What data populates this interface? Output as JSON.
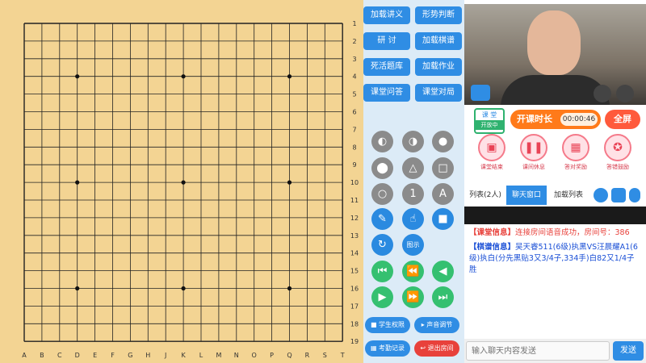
{
  "board": {
    "col_labels": [
      "A",
      "B",
      "C",
      "D",
      "E",
      "F",
      "G",
      "H",
      "J",
      "K",
      "L",
      "M",
      "N",
      "O",
      "P",
      "Q",
      "R",
      "S",
      "T"
    ],
    "row_labels": [
      "1",
      "2",
      "3",
      "4",
      "5",
      "6",
      "7",
      "8",
      "9",
      "10",
      "11",
      "12",
      "13",
      "14",
      "15",
      "16",
      "17",
      "18",
      "19"
    ],
    "star_points": [
      "D4",
      "K4",
      "Q4",
      "D10",
      "K10",
      "Q10",
      "D16",
      "K16",
      "Q16"
    ]
  },
  "panel_buttons": {
    "load_lecture": "加载讲义",
    "judge_situation": "形势判断",
    "discuss": "研 讨",
    "load_record": "加载棋谱",
    "life_death": "死活题库",
    "load_homework": "加载作业",
    "class_qa": "课堂问答",
    "class_match": "课堂对局"
  },
  "tools": {
    "text_1": "1",
    "text_A": "A",
    "show": "图示"
  },
  "bottom_buttons": {
    "student_perm": "学生权限",
    "sound_adjust": "声音调节",
    "attendance": "考勤记录",
    "exit_room": "退出房间"
  },
  "status": {
    "class_tag_top": "课 堂",
    "class_tag_bottom": "开放中",
    "duration_label": "开课时长",
    "duration_value": "00:00:46",
    "fullscreen": "全屏"
  },
  "rewards": [
    "课堂结束",
    "课间休息",
    "答对奖励",
    "答错鼓励"
  ],
  "tabs": {
    "list": "列表(2人)",
    "chat": "聊天窗口",
    "load_list": "加载列表"
  },
  "chat": {
    "msg1_tag": "【课堂信息】",
    "msg1_text": "连接房间语音成功，房间号：386",
    "msg2_tag": "【棋谱信息】",
    "msg2_text": "吴天睿511(6级)执黑VS汪晨耀A1(6级)执白(分先黑贴3又3/4子,334手)白82又1/4子胜"
  },
  "input": {
    "placeholder": "输入聊天内容发送",
    "send": "发送"
  },
  "colors": {
    "board": "#f3d493",
    "accent_blue": "#2f8de4",
    "accent_green": "#35c070",
    "accent_red": "#e8413b",
    "accent_orange": "#ff7a1a"
  }
}
